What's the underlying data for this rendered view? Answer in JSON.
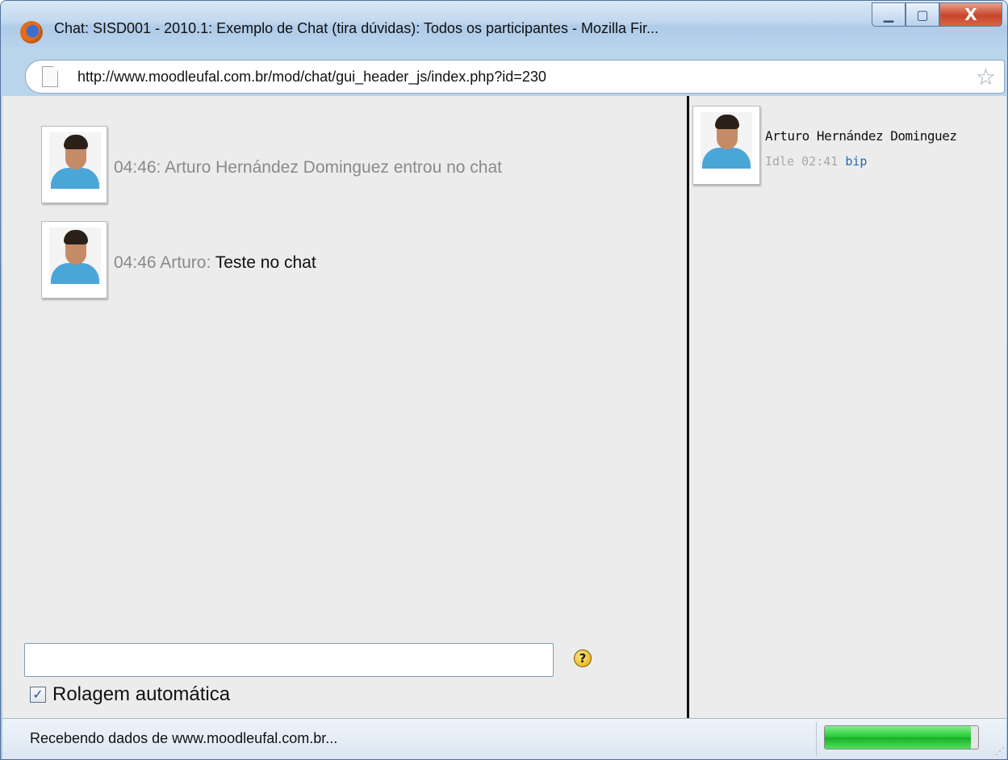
{
  "window": {
    "title": "Chat: SISD001 - 2010.1: Exemplo de Chat (tira dúvidas): Todos os participantes - Mozilla Fir...",
    "minimize": "▁",
    "maximize": "▢",
    "close": "X"
  },
  "address": {
    "url": "http://www.moodleufal.com.br/mod/chat/gui_header_js/index.php?id=230",
    "star": "☆"
  },
  "messages": [
    {
      "time": "04:46:",
      "sys_text": "Arturo Hernández Dominguez entrou no chat"
    },
    {
      "time": "04:46",
      "user": "Arturo",
      "sep": ":",
      "text": "Teste no chat"
    }
  ],
  "input": {
    "value": "",
    "help": "?"
  },
  "autoscroll": {
    "checked": "✓",
    "label": "Rolagem automática"
  },
  "users": [
    {
      "name": "Arturo Hernández Dominguez",
      "idle": "Idle 02:41",
      "bip": "bip"
    }
  ],
  "status": {
    "text": "Recebendo dados de www.moodleufal.com.br...",
    "progress_fraction": 0.95
  },
  "colors": {
    "accent": "#2268b3",
    "muted": "#8a8a8a",
    "progress": "#22c832"
  }
}
